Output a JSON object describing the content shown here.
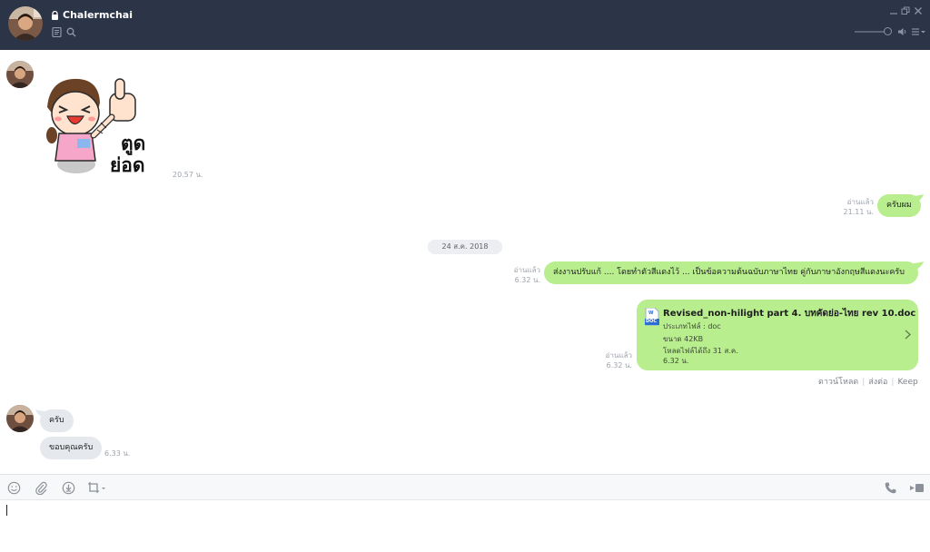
{
  "header": {
    "contact_name": "Chalermchai"
  },
  "messages": {
    "sticker_time": "20.57 น.",
    "reply1": {
      "read": "อ่านแล้ว",
      "time": "21.11 น.",
      "text": "ครับผม"
    },
    "date_separator": "24 ส.ค. 2018",
    "reply2": {
      "read": "อ่านแล้ว",
      "time": "6.32 น.",
      "text": "ส่งงานปรับแก้ .... โดยทำตัวสีแดงไว้ ... เป็นข้อความต้นฉบับภาษาไทย คู่กับภาษาอังกฤษสีแดงนะครับ"
    },
    "file": {
      "read": "อ่านแล้ว",
      "time_left": "6.32 น.",
      "icon_label_top": "W",
      "icon_label_bottom": "DOC",
      "name": "Revised_non-hilight part 4. บทคัดย่อ-ไทย rev 10.doc",
      "type_line": "ประเภทไฟล์ : doc",
      "size_line": "ขนาด 42KB",
      "expiry_line": "โหลดไฟล์ได้ถึง 31 ส.ค.",
      "time_inside": "6.32 น.",
      "download": "ดาวน์โหลด",
      "share": "ส่งต่อ",
      "keep": "Keep"
    },
    "incoming1": {
      "text": "ครับ"
    },
    "incoming2": {
      "text": "ขอบคุณครับ",
      "time": "6.33 น."
    }
  },
  "colors": {
    "header_bg": "#2c3447",
    "bubble_out": "#b8ee8e",
    "bubble_in": "#e5e8ed"
  },
  "icons": [
    "lock-icon",
    "notes-icon",
    "search-icon",
    "minimize-icon",
    "restore-icon",
    "close-icon",
    "volume-icon",
    "menu-icon",
    "emoji-icon",
    "attach-icon",
    "save-icon",
    "screenshot-icon",
    "call-icon",
    "video-call-icon",
    "chevron-right-icon"
  ]
}
